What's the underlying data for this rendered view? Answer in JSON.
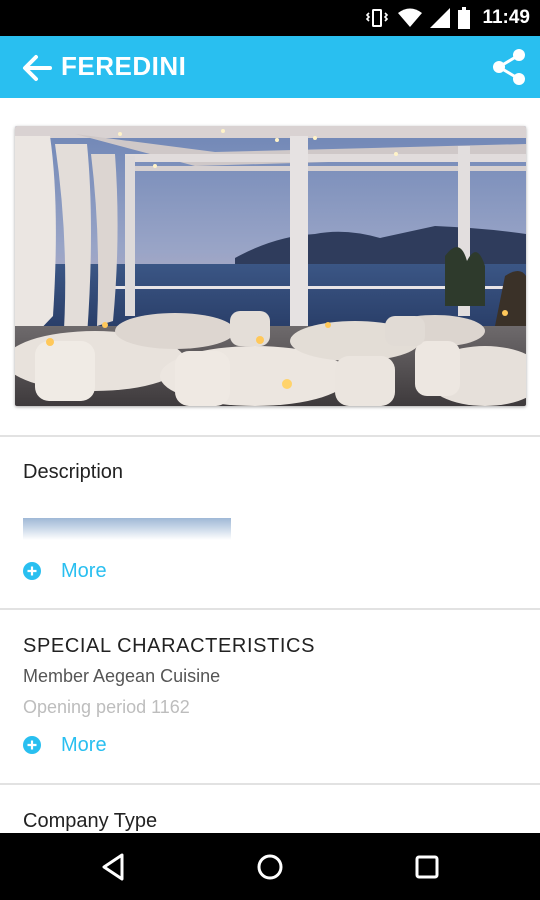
{
  "status_bar": {
    "time": "11:49",
    "icons": [
      "vibrate-icon",
      "wifi-icon",
      "signal-icon",
      "battery-icon"
    ]
  },
  "app_bar": {
    "title": "FEREDINI",
    "back_icon": "arrow-left-icon",
    "share_icon": "share-icon",
    "color": "#29bff0"
  },
  "sections": {
    "description": {
      "title": "Description",
      "more_label": "More"
    },
    "special": {
      "title": "SPECIAL CHARACTERISTICS",
      "line1": "Member Aegean Cuisine",
      "line2": "Opening period 1162",
      "more_label": "More"
    },
    "company": {
      "title": "Company Type"
    }
  },
  "accent_color": "#29bff0",
  "nav_bar": {
    "icons": [
      "back-triangle-icon",
      "home-circle-icon",
      "recents-square-icon"
    ]
  }
}
